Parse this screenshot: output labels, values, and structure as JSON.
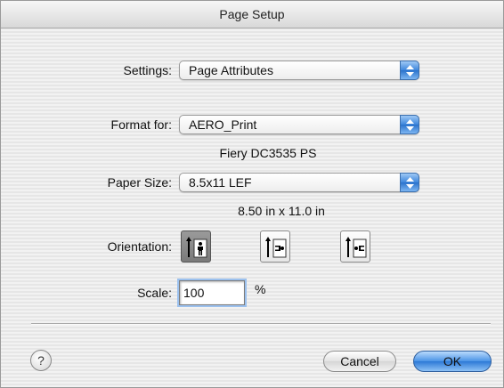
{
  "window": {
    "title": "Page Setup"
  },
  "settings": {
    "label": "Settings:",
    "value": "Page Attributes"
  },
  "format_for": {
    "label": "Format for:",
    "value": "AERO_Print",
    "printer_model": "Fiery DC3535 PS"
  },
  "paper_size": {
    "label": "Paper Size:",
    "value": "8.5x11 LEF",
    "dimensions": "8.50 in x 11.0 in"
  },
  "orientation": {
    "label": "Orientation:",
    "options": [
      "portrait",
      "landscape-left",
      "landscape-right"
    ],
    "selected": "portrait"
  },
  "scale": {
    "label": "Scale:",
    "value": "100",
    "unit": "%"
  },
  "buttons": {
    "help": "?",
    "cancel": "Cancel",
    "ok": "OK"
  },
  "colors": {
    "accent": "#3d86dc",
    "background": "#ececec"
  }
}
